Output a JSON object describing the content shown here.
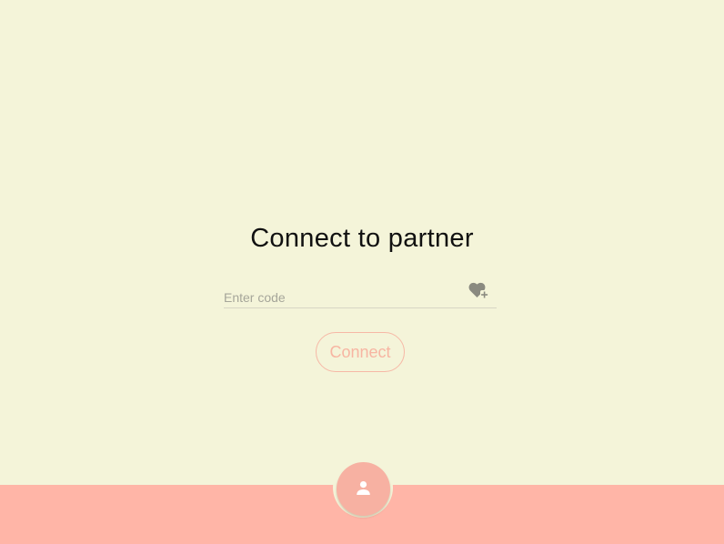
{
  "page": {
    "title": "Connect to partner"
  },
  "code_input": {
    "placeholder": "Enter code",
    "value": "",
    "icon": "heart-plus-icon"
  },
  "connect_button": {
    "label": "Connect"
  },
  "bottom_nav": {
    "profile_icon": "person-icon"
  },
  "colors": {
    "background": "#f4f4d9",
    "accent": "#ffb5a7",
    "button_text": "#f7b5a2",
    "icon": "#8a8a80"
  }
}
